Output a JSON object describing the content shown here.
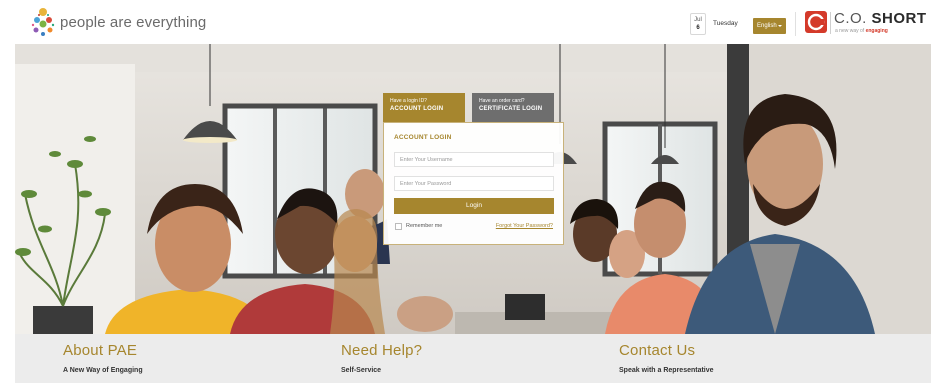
{
  "header": {
    "logo_text": "people are everything",
    "date_month": "Jul",
    "date_day": "6",
    "weekday": "Tuesday",
    "language": "English",
    "company_name_light": "C.O.",
    "company_name_bold": "SHORT",
    "company_tagline_prefix": "a new way of",
    "company_tagline_bold": "engaging"
  },
  "login": {
    "tabs": [
      {
        "pre": "Have a login ID?",
        "label": "ACCOUNT LOGIN"
      },
      {
        "pre": "Have an order card?",
        "label": "CERTIFICATE LOGIN"
      }
    ],
    "title": "ACCOUNT LOGIN",
    "username_placeholder": "Enter Your Username",
    "password_placeholder": "Enter Your Password",
    "login_button": "Login",
    "remember_label": "Remember me",
    "forgot_link": "Forgot Your Password?"
  },
  "footer": {
    "columns": [
      {
        "title": "About PAE",
        "subtitle": "A New Way of Engaging"
      },
      {
        "title": "Need Help?",
        "subtitle": "Self-Service"
      },
      {
        "title": "Contact Us",
        "subtitle": "Speak with a Representative"
      }
    ]
  },
  "colors": {
    "accent_gold": "#a6862e",
    "tab_grey": "#6e6e6e",
    "brand_red": "#d43a2a",
    "footer_bg": "#ececec"
  }
}
